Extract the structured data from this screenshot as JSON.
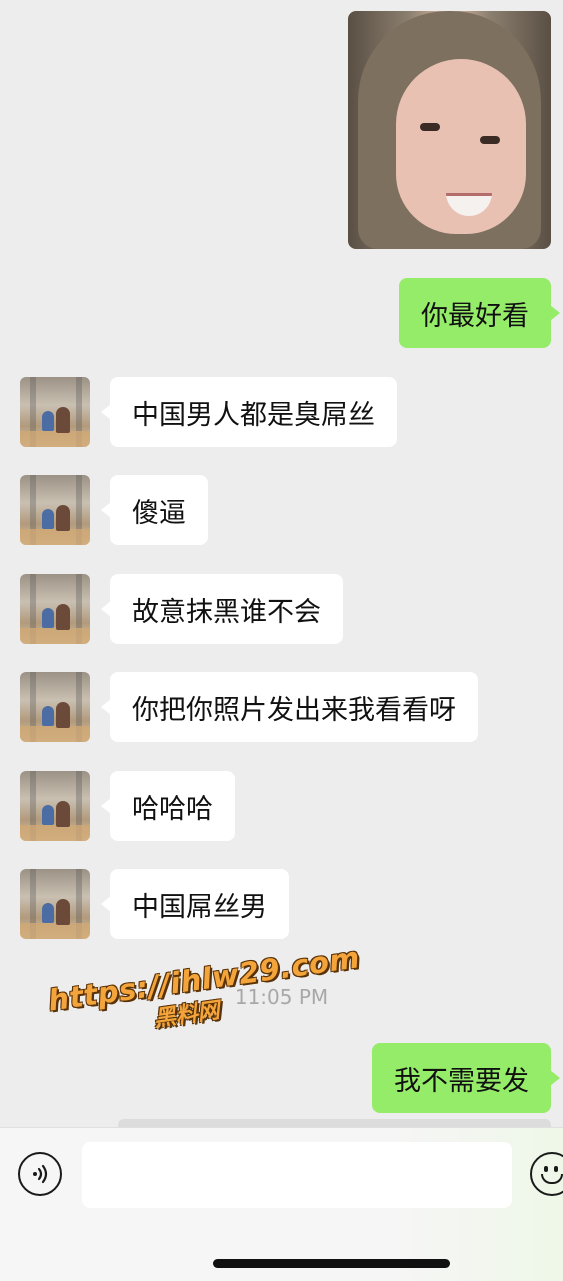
{
  "chat": {
    "timestamp": "11:05 PM",
    "messages": [
      {
        "side": "right",
        "type": "image",
        "description": "photo"
      },
      {
        "side": "right",
        "type": "text",
        "text": "你最好看"
      },
      {
        "side": "left",
        "type": "text",
        "text": "中国男人都是臭屌丝"
      },
      {
        "side": "left",
        "type": "text",
        "text": "傻逼"
      },
      {
        "side": "left",
        "type": "text",
        "text": "故意抹黑谁不会"
      },
      {
        "side": "left",
        "type": "text",
        "text": "你把你照片发出来我看看呀"
      },
      {
        "side": "left",
        "type": "text",
        "text": "哈哈哈"
      },
      {
        "side": "left",
        "type": "text",
        "text": "中国屌丝男"
      },
      {
        "side": "right",
        "type": "text",
        "text": "我不需要发"
      }
    ]
  },
  "watermark": {
    "url": "https://ihlw29.com",
    "label": "黑料网"
  },
  "input_bar": {
    "value": "",
    "voice_icon": "voice-icon",
    "emoji_icon": "emoji-icon"
  },
  "colors": {
    "background": "#ededed",
    "sent_bubble": "#95ec69",
    "received_bubble": "#ffffff",
    "timestamp": "#a8a8a8",
    "watermark": "#f3a43a"
  }
}
